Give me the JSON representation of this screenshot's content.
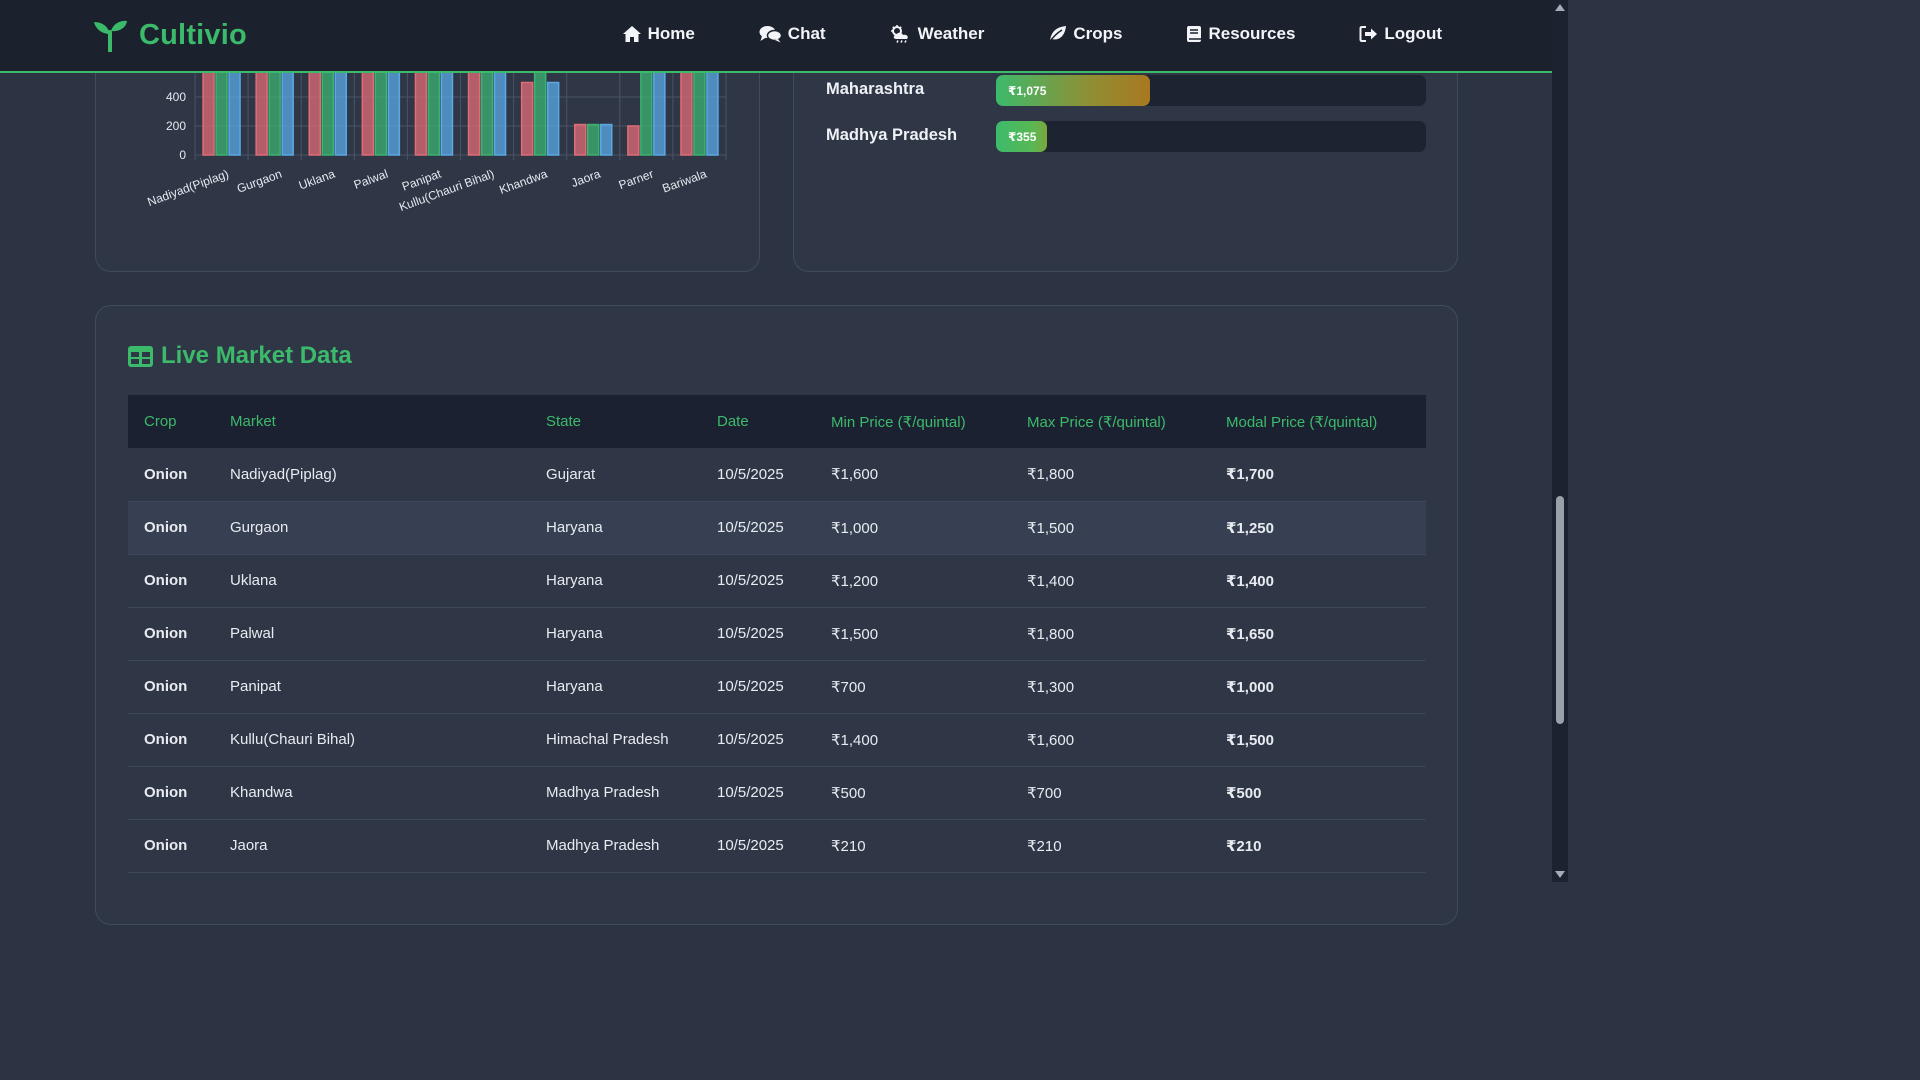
{
  "nav": {
    "brand": "Cultivio",
    "links": [
      {
        "label": "Home",
        "icon": "home-icon"
      },
      {
        "label": "Chat",
        "icon": "chat-icon"
      },
      {
        "label": "Weather",
        "icon": "weather-icon"
      },
      {
        "label": "Crops",
        "icon": "leaf-icon"
      },
      {
        "label": "Resources",
        "icon": "book-icon"
      },
      {
        "label": "Logout",
        "icon": "logout-icon"
      }
    ]
  },
  "colors": {
    "accent": "#3cba6b",
    "series_1": "#e06c75",
    "series_2": "#3cb371",
    "series_3": "#5aa9e6"
  },
  "chart_data": {
    "type": "bar",
    "categories": [
      "Nadiyad(Piplag)",
      "Gurgaon",
      "Uklana",
      "Palwal",
      "Panipat",
      "Kullu(Chauri Bihal)",
      "Khandwa",
      "Jaora",
      "Parner",
      "Bariwala"
    ],
    "series": [
      {
        "values": [
          1600,
          1000,
          1200,
          1500,
          700,
          1400,
          500,
          210,
          200,
          1000
        ]
      },
      {
        "values": [
          1800,
          1500,
          1400,
          1800,
          1300,
          1600,
          700,
          210,
          1000,
          1200
        ]
      },
      {
        "values": [
          1700,
          1250,
          1400,
          1650,
          1000,
          1500,
          500,
          210,
          800,
          1100
        ]
      }
    ],
    "yticks": [
      "0",
      "200",
      "400"
    ],
    "ylim": [
      0,
      2000
    ],
    "grid": true
  },
  "state_prices": [
    {
      "state": "Maharashtra",
      "label": "₹1,075",
      "value": 1075
    },
    {
      "state": "Madhya Pradesh",
      "label": "₹355",
      "value": 355
    }
  ],
  "state_scale_max": 3000,
  "market": {
    "title": "Live Market Data",
    "columns": [
      "Crop",
      "Market",
      "State",
      "Date",
      "Min Price (₹/quintal)",
      "Max Price (₹/quintal)",
      "Modal Price (₹/quintal)"
    ],
    "rows": [
      [
        "Onion",
        "Nadiyad(Piplag)",
        "Gujarat",
        "10/5/2025",
        "₹1,600",
        "₹1,800",
        "₹1,700"
      ],
      [
        "Onion",
        "Gurgaon",
        "Haryana",
        "10/5/2025",
        "₹1,000",
        "₹1,500",
        "₹1,250"
      ],
      [
        "Onion",
        "Uklana",
        "Haryana",
        "10/5/2025",
        "₹1,200",
        "₹1,400",
        "₹1,400"
      ],
      [
        "Onion",
        "Palwal",
        "Haryana",
        "10/5/2025",
        "₹1,500",
        "₹1,800",
        "₹1,650"
      ],
      [
        "Onion",
        "Panipat",
        "Haryana",
        "10/5/2025",
        "₹700",
        "₹1,300",
        "₹1,000"
      ],
      [
        "Onion",
        "Kullu(Chauri Bihal)",
        "Himachal Pradesh",
        "10/5/2025",
        "₹1,400",
        "₹1,600",
        "₹1,500"
      ],
      [
        "Onion",
        "Khandwa",
        "Madhya Pradesh",
        "10/5/2025",
        "₹500",
        "₹700",
        "₹500"
      ],
      [
        "Onion",
        "Jaora",
        "Madhya Pradesh",
        "10/5/2025",
        "₹210",
        "₹210",
        "₹210"
      ]
    ]
  }
}
